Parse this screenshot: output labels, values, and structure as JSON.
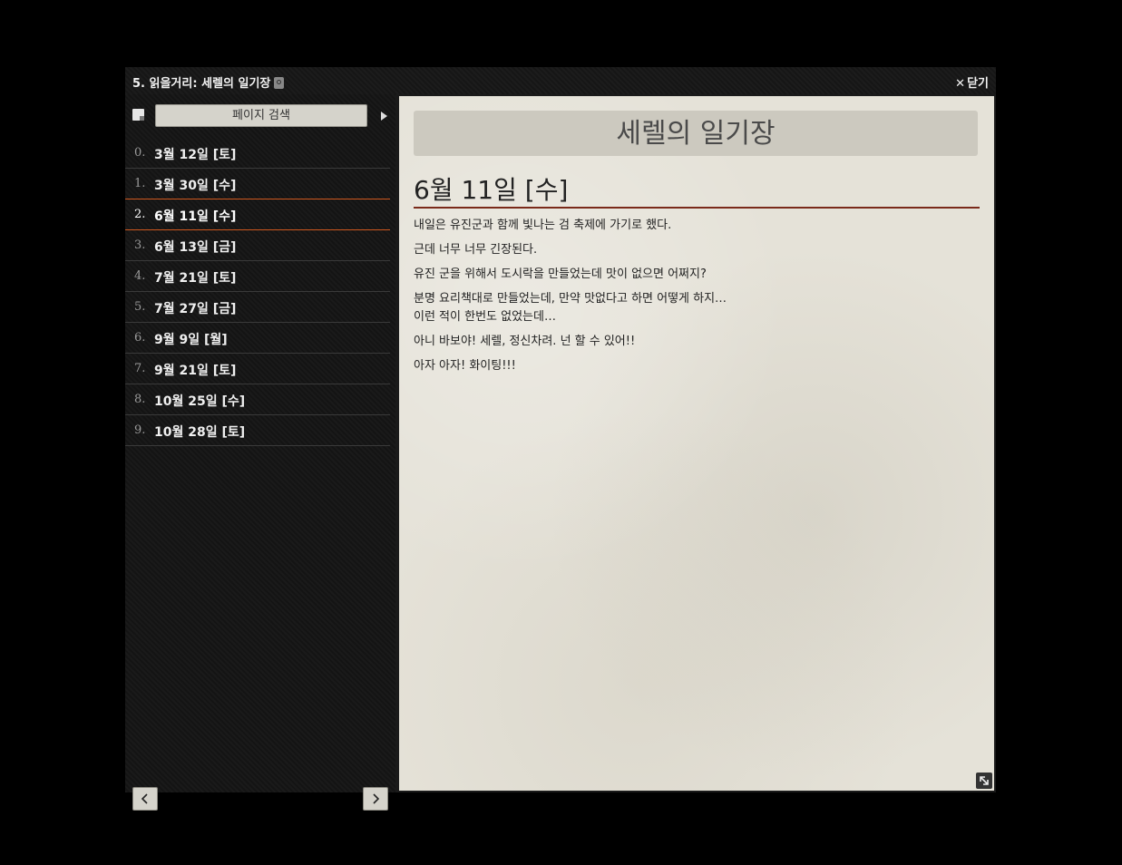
{
  "window": {
    "title": "5. 읽을거리: 세렐의 일기장",
    "close_label": "닫기"
  },
  "sidebar": {
    "search_label": "페이지 검색",
    "items": [
      {
        "num": "0.",
        "label": "3월 12일 [토]"
      },
      {
        "num": "1.",
        "label": "3월 30일 [수]"
      },
      {
        "num": "2.",
        "label": "6월 11일 [수]"
      },
      {
        "num": "3.",
        "label": "6월 13일 [금]"
      },
      {
        "num": "4.",
        "label": "7월 21일 [토]"
      },
      {
        "num": "5.",
        "label": "7월 27일 [금]"
      },
      {
        "num": "6.",
        "label": "9월 9일 [월]"
      },
      {
        "num": "7.",
        "label": "9월 21일 [토]"
      },
      {
        "num": "8.",
        "label": "10월 25일 [수]"
      },
      {
        "num": "9.",
        "label": "10월 28일 [토]"
      }
    ],
    "active_index": 2
  },
  "content": {
    "doc_title": "세렐의 일기장",
    "entry_heading": "6월 11일 [수]",
    "paragraphs": [
      "내일은 유진군과 함께 빛나는 검 축제에 가기로 했다.",
      "근데 너무 너무 긴장된다.",
      "유진 군을 위해서 도시락을 만들었는데 맛이 없으면 어쩌지?",
      "분명 요리책대로 만들었는데, 만약 맛없다고 하면 어떻게 하지…\n이런 적이 한번도 없었는데…",
      "아니 바보야! 세렐, 정신차려. 넌 할 수 있어!!",
      "아자 아자! 화이팅!!!"
    ]
  },
  "colors": {
    "accent_line": "#d0581e",
    "heading_rule": "#7a2a1a",
    "paper": "#e5e2d8"
  }
}
